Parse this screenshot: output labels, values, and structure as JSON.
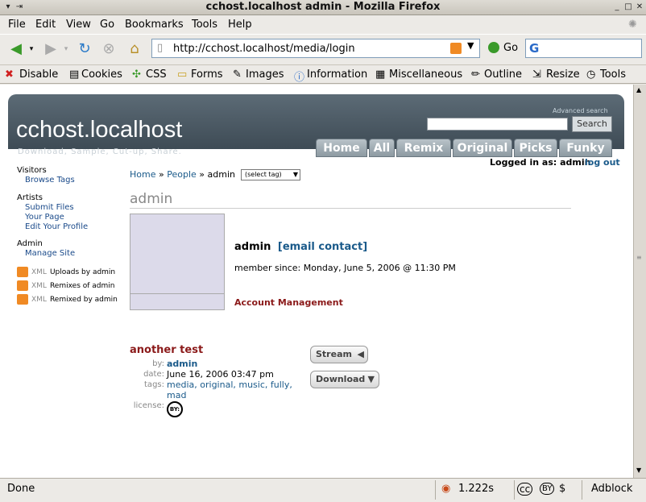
{
  "window": {
    "title": "cchost.localhost admin - Mozilla Firefox"
  },
  "menu": [
    "File",
    "Edit",
    "View",
    "Go",
    "Bookmarks",
    "Tools",
    "Help"
  ],
  "nav": {
    "url": "http://cchost.localhost/media/login",
    "go": "Go"
  },
  "devtoolbar": [
    "Disable",
    "Cookies",
    "CSS",
    "Forms",
    "Images",
    "Information",
    "Miscellaneous",
    "Outline",
    "Resize",
    "Tools"
  ],
  "site": {
    "name": "cchost.localhost",
    "tagline": "Download, Sample, Cut-up, Share.",
    "adv_search": "Advanced search",
    "search_btn": "Search",
    "tabs": [
      "Home",
      "All",
      "Remix",
      "Original",
      "Picks",
      "Funky"
    ]
  },
  "sidebar": {
    "visitors": "Visitors",
    "browse_tags": "Browse Tags",
    "artists": "Artists",
    "submit_files": "Submit Files",
    "your_page": "Your Page",
    "edit_profile": "Edit Your Profile",
    "admin": "Admin",
    "manage_site": "Manage Site",
    "feeds": [
      {
        "x": "XML",
        "label": "Uploads by admin"
      },
      {
        "x": "XML",
        "label": "Remixes of admin"
      },
      {
        "x": "XML",
        "label": "Remixed by admin"
      }
    ]
  },
  "breadcrumb": {
    "home": "Home",
    "sep": "»",
    "people": "People",
    "user": "admin",
    "select": "(select tag)"
  },
  "login": {
    "logged": "Logged in as: admin",
    "logout": "log out"
  },
  "profile": {
    "heading": "admin",
    "name": "admin",
    "email": "[email contact]",
    "since": "member since: Monday, June 5, 2006 @ 11:30 PM",
    "account": "Account Management"
  },
  "upload": {
    "title": "another test",
    "by_label": "by:",
    "by": "admin",
    "date_label": "date:",
    "date": "June 16, 2006 03:47 pm",
    "tags_label": "tags:",
    "tags": "media, original, music, fully,",
    "tags2": "mad",
    "license_label": "license:",
    "license_badge": "BY:",
    "stream": "Stream",
    "download": "Download"
  },
  "status": {
    "text": "Done",
    "time": "1.222s",
    "adblock": "Adblock"
  }
}
